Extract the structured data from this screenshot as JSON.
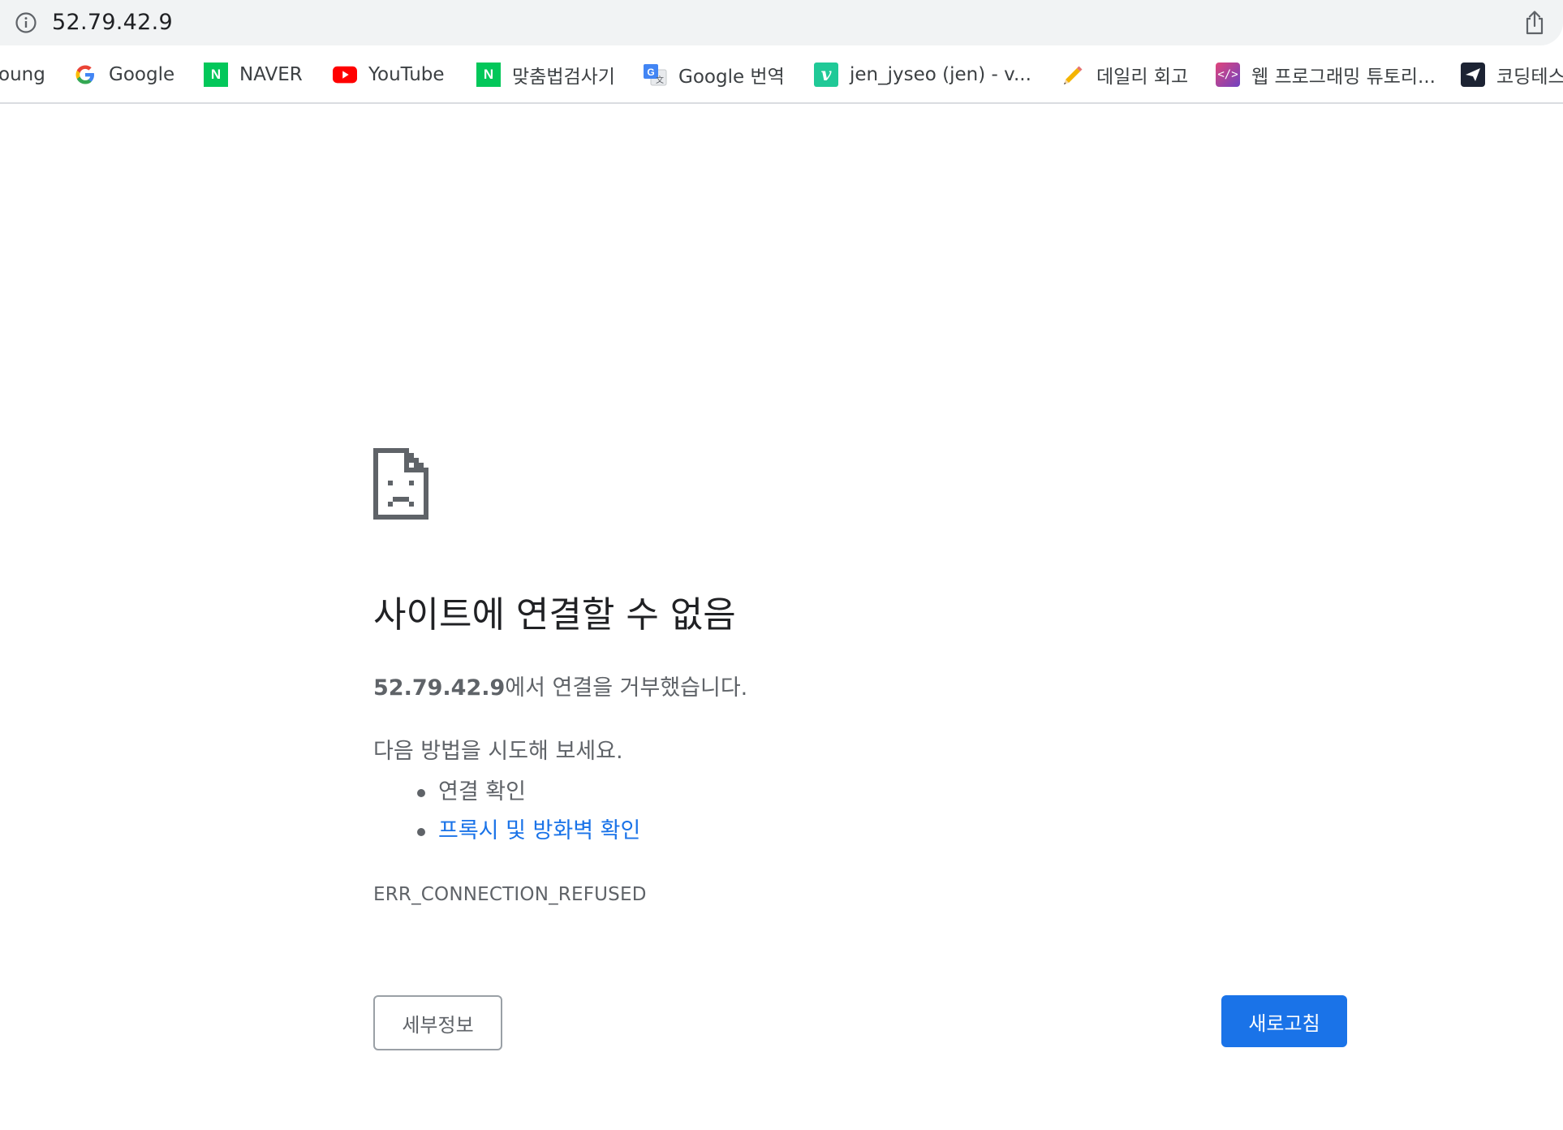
{
  "address_bar": {
    "url": "52.79.42.9"
  },
  "bookmarks": [
    {
      "label": "oung",
      "icon": "none"
    },
    {
      "label": "Google",
      "icon": "google-icon"
    },
    {
      "label": "NAVER",
      "icon": "naver-icon"
    },
    {
      "label": "YouTube",
      "icon": "youtube-icon"
    },
    {
      "label": "맞춤법검사기",
      "icon": "naver-icon"
    },
    {
      "label": "Google 번역",
      "icon": "google-translate-icon"
    },
    {
      "label": "jen_jyseo (jen) - v...",
      "icon": "velog-icon"
    },
    {
      "label": "데일리 회고",
      "icon": "pencil-icon"
    },
    {
      "label": "웹 프로그래밍 튜토리...",
      "icon": "code-icon"
    },
    {
      "label": "코딩테스",
      "icon": "bird-icon"
    }
  ],
  "error": {
    "title": "사이트에 연결할 수 없음",
    "host": "52.79.42.9",
    "desc_suffix": "에서 연결을 거부했습니다.",
    "suggest_heading": "다음 방법을 시도해 보세요.",
    "suggestions": [
      {
        "text": "연결 확인",
        "link": false
      },
      {
        "text": "프록시 및 방화벽 확인",
        "link": true
      }
    ],
    "code": "ERR_CONNECTION_REFUSED"
  },
  "buttons": {
    "details_label": "세부정보",
    "reload_label": "새로고침"
  },
  "colors": {
    "accent": "#1a73e8",
    "secondary_text": "#5f6368",
    "address_bar_bg": "#f1f3f4"
  }
}
